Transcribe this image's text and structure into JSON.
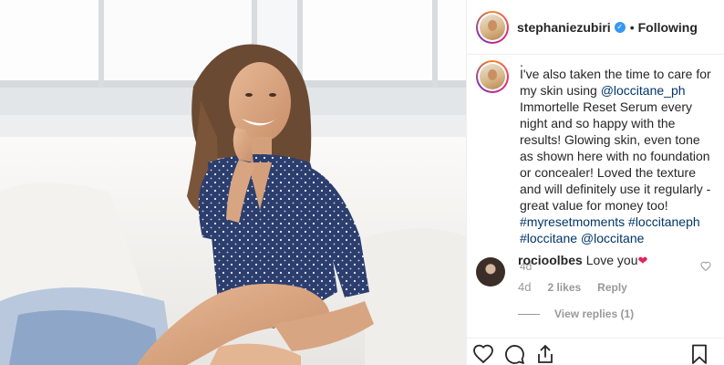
{
  "post": {
    "author": "stephaniezubiri",
    "verified_badge": "✓",
    "separator": "•",
    "follow_state": "Following"
  },
  "caption": {
    "leading_dot": ".",
    "text_1": "I've also taken the time to care for my skin using ",
    "mention_1": "@loccitane_ph",
    "text_2": " Immortelle Reset Serum every night and so happy with the results! Glowing skin, even tone as shown here with no foundation or concealer! Loved the texture and will definitely use it regularly - great value for money too! ",
    "tags": "#myresetmoments #loccitaneph #loccitane @loccitane",
    "time": "4d"
  },
  "comment": {
    "username": "rocioolbes",
    "text": "Love you",
    "emoji": "❤",
    "time": "4d",
    "likes": "2 likes",
    "reply": "Reply"
  },
  "view_replies": "View replies (1)",
  "icons": {
    "like": "heart-outline-icon",
    "comment": "comment-bubble-icon",
    "share": "share-upload-icon",
    "save": "bookmark-icon",
    "comment_like": "small-heart-icon"
  },
  "colors": {
    "link": "#003569",
    "verified": "#3897f0",
    "muted": "#999999",
    "text": "#262626"
  }
}
